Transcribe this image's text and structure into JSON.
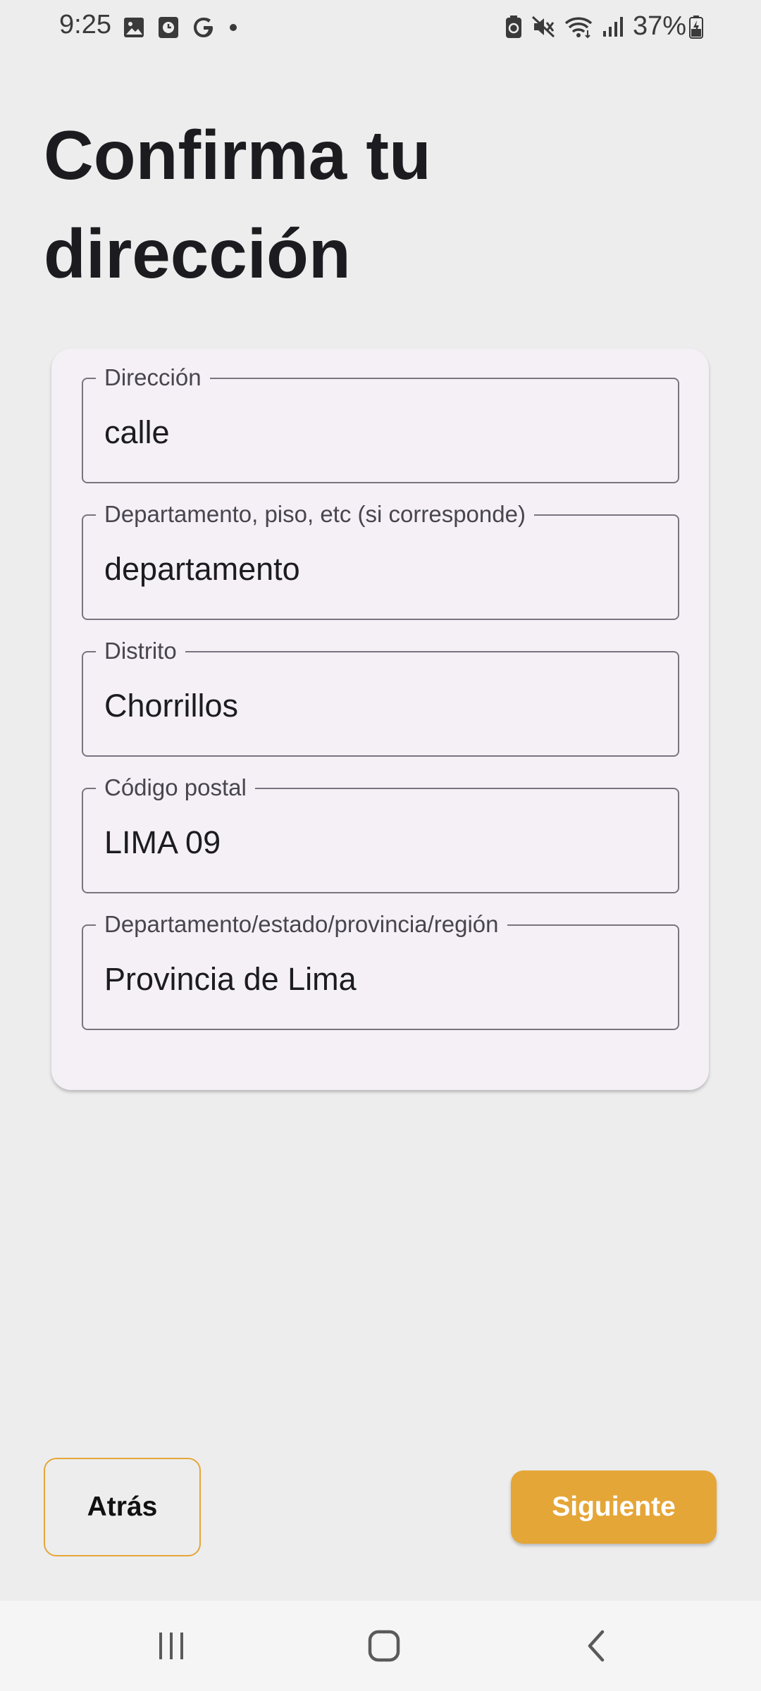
{
  "status_bar": {
    "time": "9:25",
    "battery": "37%",
    "left_icons": [
      "image-icon",
      "clock-app-icon",
      "google-icon",
      "dot-icon"
    ],
    "right_icons": [
      "battery-saver-icon",
      "mute-icon",
      "wifi-icon",
      "signal-icon",
      "battery-icon"
    ]
  },
  "page": {
    "title": "Confirma tu dirección"
  },
  "form": {
    "fields": [
      {
        "label": "Dirección",
        "value": "calle"
      },
      {
        "label": "Departamento, piso, etc (si corresponde)",
        "value": "departamento"
      },
      {
        "label": "Distrito",
        "value": "Chorrillos"
      },
      {
        "label": "Código postal",
        "value": "LIMA 09"
      },
      {
        "label": "Departamento/estado/provincia/región",
        "value": "Provincia de Lima"
      }
    ]
  },
  "actions": {
    "back_label": "Atrás",
    "next_label": "Siguiente"
  },
  "nav_bar": {
    "items": [
      "recent-apps-icon",
      "home-icon",
      "back-icon"
    ]
  },
  "colors": {
    "accent": "#e5a638",
    "card_background": "#f4f0f6",
    "page_background": "#ededed",
    "field_border": "#79747e"
  }
}
